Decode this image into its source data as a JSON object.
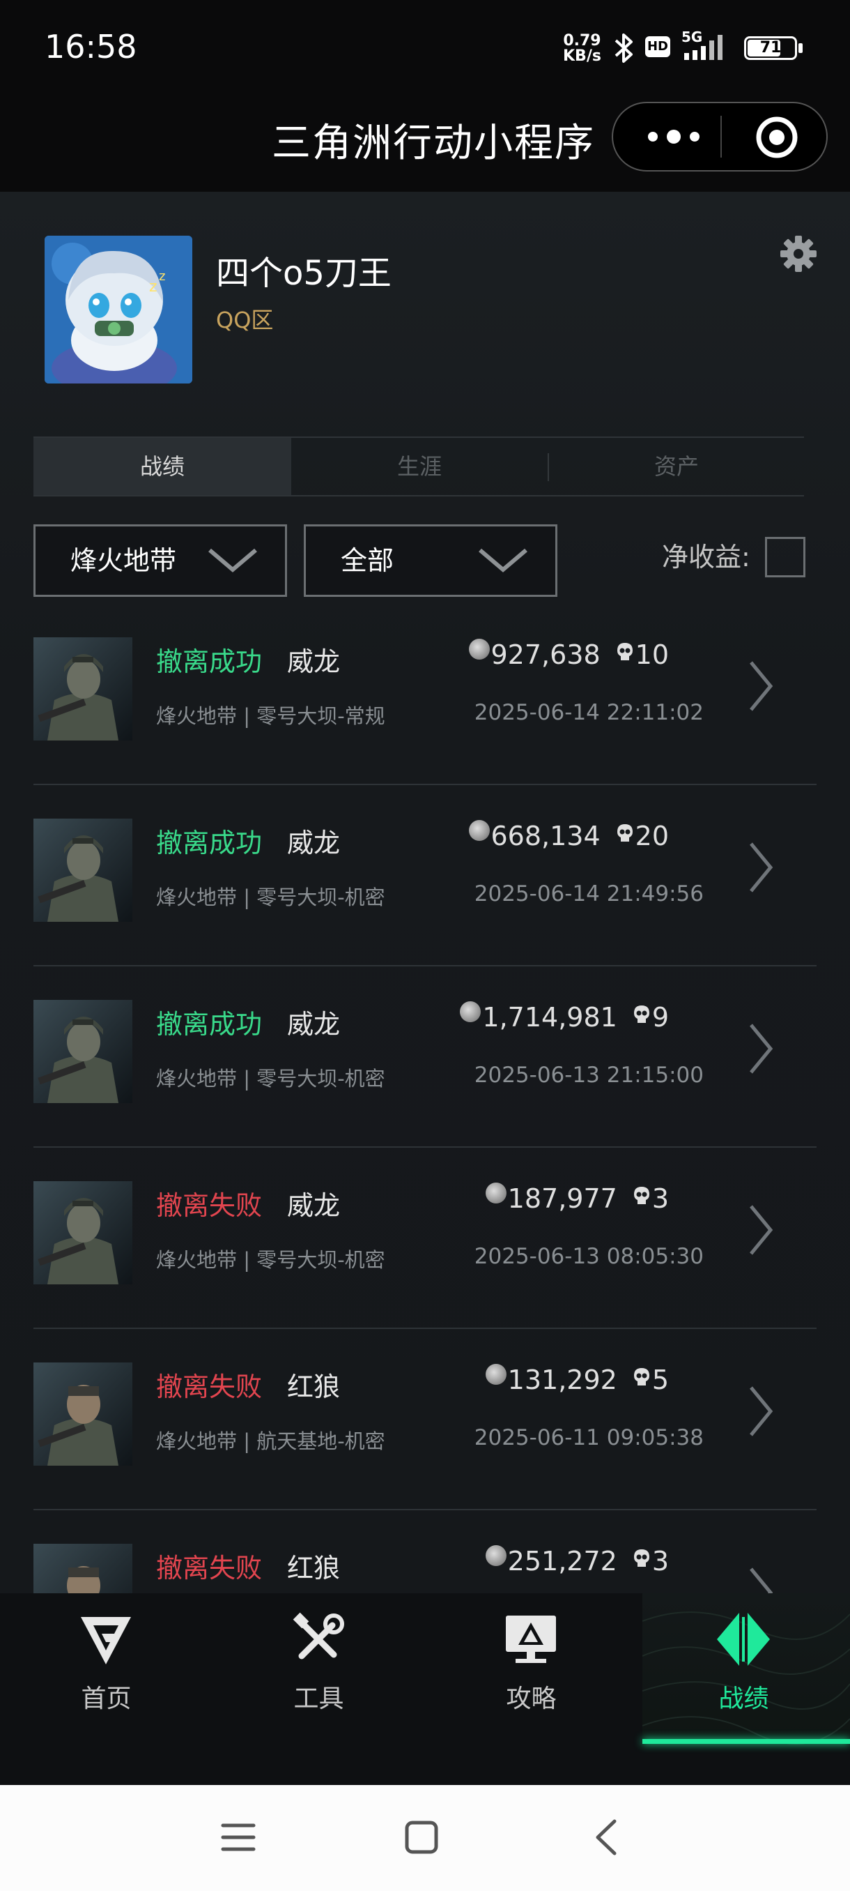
{
  "status_bar": {
    "time": "16:58",
    "net_speed_value": "0.79",
    "net_speed_unit": "KB/s",
    "hd": "HD",
    "network": "5G",
    "battery": "71",
    "battery_level": 0.71
  },
  "title_bar": {
    "title": "三角洲行动小程序",
    "more_icon": "more-dots-icon",
    "close_icon": "target-close-icon"
  },
  "profile": {
    "nickname": "四个o5刀王",
    "region": "QQ区",
    "settings_icon": "gear-icon"
  },
  "tabs": [
    {
      "label": "战绩",
      "active": true
    },
    {
      "label": "生涯",
      "active": false
    },
    {
      "label": "资产",
      "active": false
    }
  ],
  "filters": {
    "mode": "烽火地带",
    "scope": "全部",
    "net_income_label": "净收益:",
    "net_income_checked": false
  },
  "colors": {
    "success": "#39d98a",
    "fail": "#e2454f",
    "accent": "#1fe99b",
    "region": "#c9a45e"
  },
  "records": [
    {
      "status": "撤离成功",
      "result": "success",
      "operator": "威龙",
      "mode_map": "烽火地带 | 零号大坝-常规",
      "money": "927,638",
      "kills": "10",
      "datetime": "2025-06-14 22:11:02"
    },
    {
      "status": "撤离成功",
      "result": "success",
      "operator": "威龙",
      "mode_map": "烽火地带 | 零号大坝-机密",
      "money": "668,134",
      "kills": "20",
      "datetime": "2025-06-14 21:49:56"
    },
    {
      "status": "撤离成功",
      "result": "success",
      "operator": "威龙",
      "mode_map": "烽火地带 | 零号大坝-机密",
      "money": "1,714,981",
      "kills": "9",
      "datetime": "2025-06-13 21:15:00"
    },
    {
      "status": "撤离失败",
      "result": "fail",
      "operator": "威龙",
      "mode_map": "烽火地带 | 零号大坝-机密",
      "money": "187,977",
      "kills": "3",
      "datetime": "2025-06-13 08:05:30"
    },
    {
      "status": "撤离失败",
      "result": "fail",
      "operator": "红狼",
      "mode_map": "烽火地带 | 航天基地-机密",
      "money": "131,292",
      "kills": "5",
      "datetime": "2025-06-11 09:05:38"
    },
    {
      "status": "撤离失败",
      "result": "fail",
      "operator": "红狼",
      "mode_map": "",
      "money": "251,272",
      "kills": "3",
      "datetime": ""
    }
  ],
  "bottom_nav": [
    {
      "label": "首页",
      "icon": "home-logo-icon",
      "active": false
    },
    {
      "label": "工具",
      "icon": "tools-icon",
      "active": false
    },
    {
      "label": "攻略",
      "icon": "guide-monitor-icon",
      "active": false
    },
    {
      "label": "战绩",
      "icon": "record-icon",
      "active": true
    }
  ],
  "system_nav": [
    "menu-icon",
    "home-square-icon",
    "back-icon"
  ]
}
